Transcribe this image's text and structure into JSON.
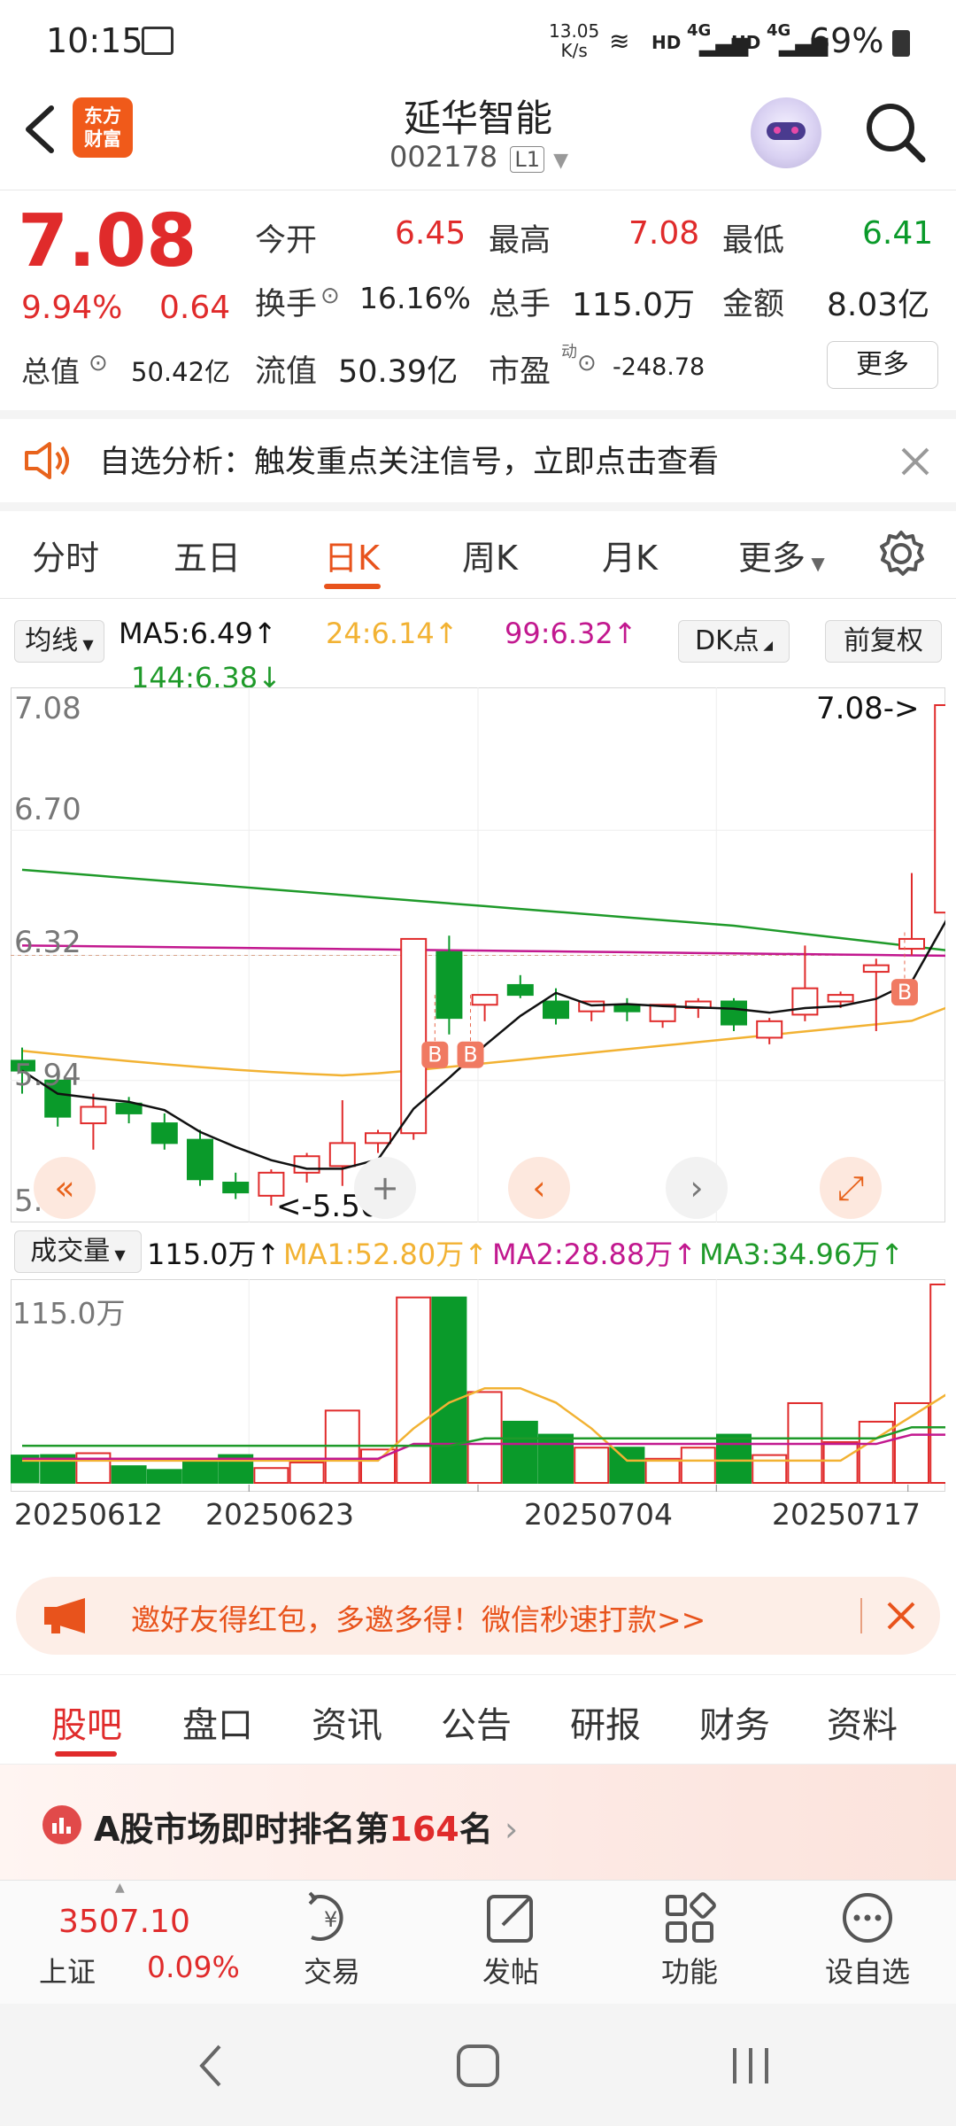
{
  "status": {
    "time": "10:15",
    "net_speed_value": "13.05",
    "net_speed_unit": "K/s",
    "hd1": "HD",
    "g4a": "4G",
    "hd2": "HD",
    "g4b": "4G",
    "battery": "69%"
  },
  "header": {
    "logo_line1": "东方",
    "logo_line2": "财富",
    "stock_name": "延华智能",
    "stock_code": "002178",
    "level": "L1"
  },
  "quote": {
    "price": "7.08",
    "change_pct": "9.94%",
    "change_abs": "0.64",
    "open_label": "今开",
    "open": "6.45",
    "high_label": "最高",
    "high": "7.08",
    "low_label": "最低",
    "low": "6.41",
    "turnover_label": "换手",
    "turnover": "16.16%",
    "volume_label": "总手",
    "volume": "115.0万",
    "amount_label": "金额",
    "amount": "8.03亿",
    "mktcap_label": "总值",
    "mktcap": "50.42亿",
    "float_label": "流值",
    "float_cap": "50.39亿",
    "pe_label": "市盈",
    "pe_sup": "动",
    "pe": "-248.78",
    "more_label": "更多"
  },
  "notice": {
    "text": "自选分析：触发重点关注信号，立即点击查看"
  },
  "chart_tabs": [
    "分时",
    "五日",
    "日K",
    "周K",
    "月K",
    "更多"
  ],
  "active_chart_tab": "日K",
  "ma_bar": {
    "selector": "均线",
    "ma5": "MA5:6.49↑",
    "ma24": "24:6.14↑",
    "ma99": "99:6.32↑",
    "ma144": "144:6.38↓",
    "dk_label": "DK点",
    "adjust_label": "前复权"
  },
  "kchart": {
    "y_labels": [
      "7.08",
      "6.70",
      "6.32",
      "5.94",
      "5.56"
    ],
    "max_marker": "7.08->",
    "min_marker": "<-5.56",
    "signal_label": "B"
  },
  "volume_bar": {
    "selector": "成交量",
    "vol": "115.0万↑",
    "ma1": "MA1:52.80万↑",
    "ma2": "MA2:28.88万↑",
    "ma3": "MA3:34.96万↑",
    "axis_label": "115.0万",
    "dates": [
      "20250612",
      "20250623",
      "20250704",
      "20250717"
    ]
  },
  "chart_data": {
    "type": "candlestick",
    "y_range": [
      5.56,
      7.08
    ],
    "candles": [
      {
        "o": 6.0,
        "h": 6.04,
        "l": 5.9,
        "c": 5.97
      },
      {
        "o": 5.94,
        "h": 5.97,
        "l": 5.8,
        "c": 5.83
      },
      {
        "o": 5.81,
        "h": 5.9,
        "l": 5.73,
        "c": 5.86
      },
      {
        "o": 5.87,
        "h": 5.89,
        "l": 5.81,
        "c": 5.84
      },
      {
        "o": 5.81,
        "h": 5.84,
        "l": 5.73,
        "c": 5.75
      },
      {
        "o": 5.76,
        "h": 5.79,
        "l": 5.62,
        "c": 5.64
      },
      {
        "o": 5.63,
        "h": 5.66,
        "l": 5.58,
        "c": 5.6
      },
      {
        "o": 5.59,
        "h": 5.67,
        "l": 5.56,
        "c": 5.66
      },
      {
        "o": 5.66,
        "h": 5.72,
        "l": 5.63,
        "c": 5.71
      },
      {
        "o": 5.68,
        "h": 5.88,
        "l": 5.62,
        "c": 5.75
      },
      {
        "o": 5.75,
        "h": 5.79,
        "l": 5.72,
        "c": 5.78
      },
      {
        "o": 5.78,
        "h": 6.37,
        "l": 5.76,
        "c": 6.37
      },
      {
        "o": 6.33,
        "h": 6.38,
        "l": 6.08,
        "c": 6.13
      },
      {
        "o": 6.17,
        "h": 6.2,
        "l": 6.12,
        "c": 6.2
      },
      {
        "o": 6.23,
        "h": 6.26,
        "l": 6.19,
        "c": 6.2
      },
      {
        "o": 6.18,
        "h": 6.22,
        "l": 6.11,
        "c": 6.13
      },
      {
        "o": 6.15,
        "h": 6.18,
        "l": 6.12,
        "c": 6.18
      },
      {
        "o": 6.17,
        "h": 6.19,
        "l": 6.12,
        "c": 6.15
      },
      {
        "o": 6.12,
        "h": 6.17,
        "l": 6.1,
        "c": 6.17
      },
      {
        "o": 6.16,
        "h": 6.19,
        "l": 6.13,
        "c": 6.18
      },
      {
        "o": 6.18,
        "h": 6.19,
        "l": 6.09,
        "c": 6.11
      },
      {
        "o": 6.07,
        "h": 6.13,
        "l": 6.05,
        "c": 6.12
      },
      {
        "o": 6.14,
        "h": 6.35,
        "l": 6.12,
        "c": 6.22
      },
      {
        "o": 6.18,
        "h": 6.21,
        "l": 6.16,
        "c": 6.2
      },
      {
        "o": 6.27,
        "h": 6.31,
        "l": 6.09,
        "c": 6.29
      },
      {
        "o": 6.34,
        "h": 6.57,
        "l": 6.32,
        "c": 6.37
      },
      {
        "o": 6.45,
        "h": 7.08,
        "l": 6.41,
        "c": 7.08
      }
    ],
    "volumes": [
      0.15,
      0.16,
      0.09,
      0.07,
      0.12,
      0.15,
      0.08,
      0.11,
      0.39,
      0.18,
      1.0,
      1.0,
      0.49,
      0.33,
      0.26,
      0.19,
      0.19,
      0.13,
      0.19,
      0.26,
      0.15,
      0.43,
      0.22,
      0.33,
      0.43,
      1.07
    ],
    "ma_lines": [
      "MA5",
      "MA24",
      "MA99",
      "MA144"
    ]
  },
  "promo": {
    "text": "邀好友得红包，多邀多得！微信秒速打款>>"
  },
  "bottom_tabs": [
    "股吧",
    "盘口",
    "资讯",
    "公告",
    "研报",
    "财务",
    "资料"
  ],
  "active_bottom_tab": "股吧",
  "ranking": {
    "prefix": "A股市场即时排名第",
    "rank": "164",
    "suffix": "名"
  },
  "bottom_nav": {
    "index_value": "3507.10",
    "index_name": "上证",
    "index_change": "0.09%",
    "items": [
      "交易",
      "发帖",
      "功能",
      "设自选"
    ]
  },
  "colors": {
    "up": "#e02b2b",
    "down": "#0a9a2a",
    "accent": "#e8531c",
    "ma5": "#111111",
    "ma24": "#f2b233",
    "ma99": "#c2188f",
    "ma144": "#1f9a2a"
  }
}
